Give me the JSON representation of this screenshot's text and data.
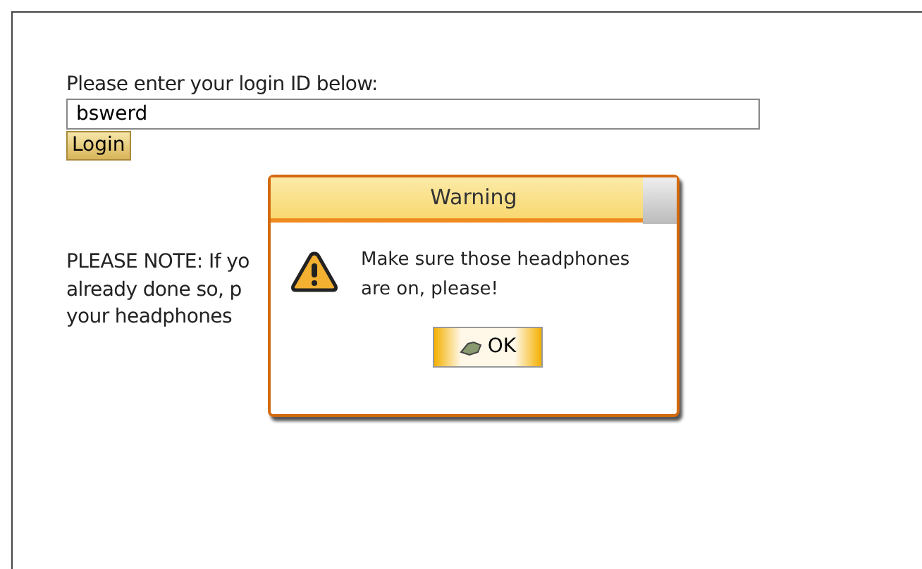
{
  "login": {
    "prompt": "Please enter your login ID below:",
    "value": "bswerd",
    "button": "Login"
  },
  "note_lines": [
    "PLEASE NOTE: If yo",
    "already done so, p",
    "your headphones"
  ],
  "dialog": {
    "title": "Warning",
    "message": "Make sure those headphones are on, please!",
    "button": "OK"
  }
}
